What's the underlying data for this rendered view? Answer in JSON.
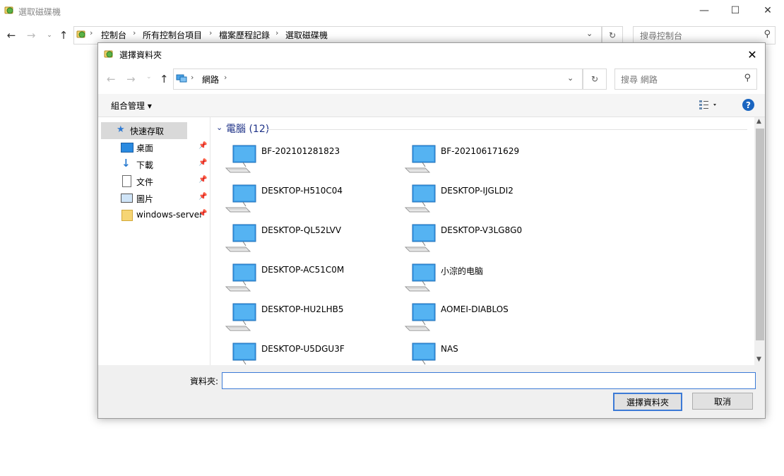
{
  "window": {
    "title": "選取磁碟機",
    "breadcrumb": [
      "控制台",
      "所有控制台項目",
      "檔案歷程記錄",
      "選取磁碟機"
    ],
    "search_placeholder": "搜尋控制台"
  },
  "dialog": {
    "title": "選擇資料夾",
    "address": [
      "網路"
    ],
    "search_placeholder": "搜尋 網路",
    "organize_label": "組合管理 ▾",
    "help": "?",
    "nav": [
      {
        "label": "快速存取",
        "icon": "star-icon",
        "pinned": false
      },
      {
        "label": "桌面",
        "icon": "desktop-icon",
        "pinned": true
      },
      {
        "label": "下載",
        "icon": "download-icon",
        "pinned": true
      },
      {
        "label": "文件",
        "icon": "document-icon",
        "pinned": true
      },
      {
        "label": "圖片",
        "icon": "picture-icon",
        "pinned": true
      },
      {
        "label": "windows-server",
        "icon": "folder-icon",
        "pinned": true
      }
    ],
    "group": {
      "name": "電腦 (12)"
    },
    "computers": [
      "BF-202101281823",
      "BF-202106171629",
      "DESKTOP-H510C04",
      "DESKTOP-IJGLDI2",
      "DESKTOP-QL52LVV",
      "DESKTOP-V3LG8G0",
      "DESKTOP-AC51C0M",
      "小淙的电脑",
      "DESKTOP-HU2LHB5",
      "AOMEI-DIABLOS",
      "DESKTOP-U5DGU3F",
      "NAS"
    ],
    "folder_label": "資料夾:",
    "folder_value": "",
    "select_button": "選擇資料夾",
    "cancel_button": "取消"
  },
  "colors": {
    "accent": "#1a65c0",
    "group_header": "#1e3287"
  }
}
